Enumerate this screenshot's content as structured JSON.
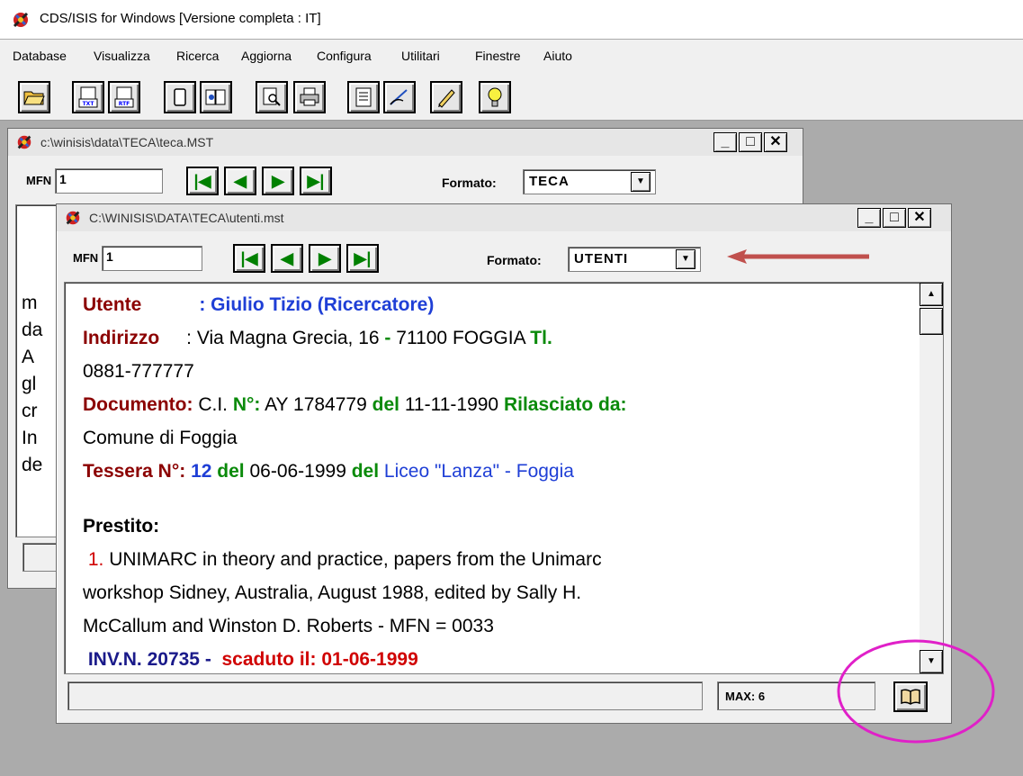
{
  "app": {
    "title": "CDS/ISIS for Windows [Versione completa : IT]",
    "menu": [
      "Database",
      "Visualizza",
      "Ricerca",
      "Aggiorna",
      "Configura",
      "Utilitari",
      "Finestre",
      "Aiuto"
    ],
    "toolbar_icons": [
      "open-folder-icon",
      "txt-export-icon",
      "rtf-export-icon",
      "copy-icon",
      "edit-record-icon",
      "preview-icon",
      "print-icon",
      "form-icon",
      "hand-edit-icon",
      "pencil-icon",
      "lightbulb-icon"
    ]
  },
  "back_window": {
    "title": "c:\\winisis\\data\\TECA\\teca.MST",
    "mfn_label": "MFN",
    "mfn_value": "1",
    "format_label": "Formato:",
    "format_value": "TECA",
    "partial_lines": [
      "m",
      "da",
      "A",
      "gl",
      "cr",
      "In",
      "de"
    ]
  },
  "front_window": {
    "title": "C:\\WINISIS\\DATA\\TECA\\utenti.mst",
    "mfn_label": "MFN",
    "mfn_value": "1",
    "format_label": "Formato:",
    "format_value": "UTENTI",
    "record": {
      "utente_label": "Utente",
      "utente_value": ": Giulio Tizio (Ricercatore)",
      "indirizzo_label": "Indirizzo",
      "indirizzo_value": ": Via Magna Grecia, 16",
      "dash": "-",
      "cap_city": "71100 FOGGIA",
      "tel_label": "Tl.",
      "tel_value": "0881-777777",
      "doc_label": "Documento:",
      "doc_type": "C.I.",
      "doc_num_label": "N°:",
      "doc_num": "AY 1784779",
      "doc_del": "del",
      "doc_date": "11-11-1990",
      "rilasciato_label": "Rilasciato da:",
      "rilasciato_value": "Comune di Foggia",
      "tessera_label": "Tessera  N°:",
      "tessera_num": "12",
      "tessera_del": "del",
      "tessera_date": "06-06-1999",
      "tessera_del2": "del",
      "tessera_school": "Liceo \"Lanza\" - Foggia",
      "prestito_label": "Prestito:",
      "loan_index": "1.",
      "loan_line1": "UNIMARC in theory and practice, papers from the Unimarc",
      "loan_line2": "workshop Sidney, Australia, August 1988, edited by Sally H.",
      "loan_line3": "McCallum and Winston D. Roberts - MFN = 0033",
      "inv_label": "INV.N. 20735 -",
      "scaduto": "scaduto il: 01-06-1999"
    },
    "status_max": "MAX: 6"
  },
  "colors": {
    "annotation_arrow": "#c0504d",
    "annotation_circle": "#e020c8"
  }
}
